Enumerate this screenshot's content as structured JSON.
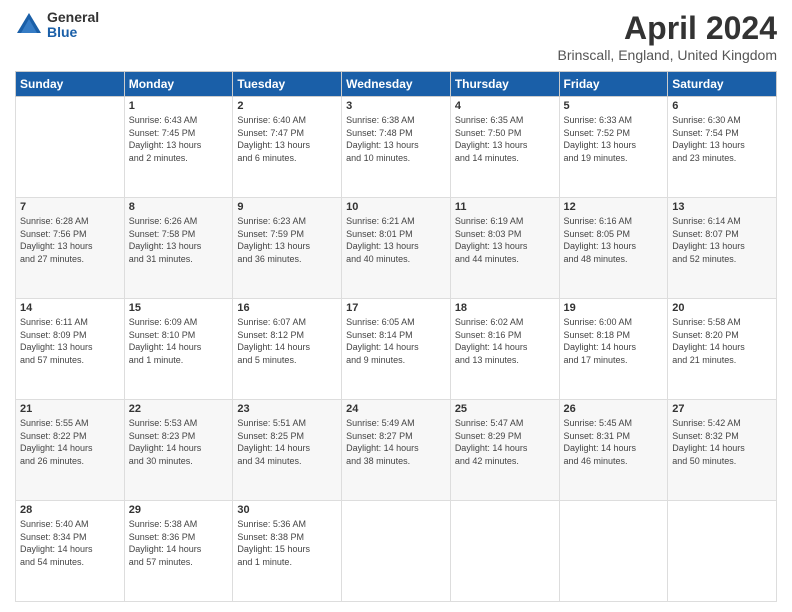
{
  "header": {
    "logo_general": "General",
    "logo_blue": "Blue",
    "main_title": "April 2024",
    "subtitle": "Brinscall, England, United Kingdom"
  },
  "calendar": {
    "days_of_week": [
      "Sunday",
      "Monday",
      "Tuesday",
      "Wednesday",
      "Thursday",
      "Friday",
      "Saturday"
    ],
    "weeks": [
      [
        {
          "num": "",
          "detail": ""
        },
        {
          "num": "1",
          "detail": "Sunrise: 6:43 AM\nSunset: 7:45 PM\nDaylight: 13 hours\nand 2 minutes."
        },
        {
          "num": "2",
          "detail": "Sunrise: 6:40 AM\nSunset: 7:47 PM\nDaylight: 13 hours\nand 6 minutes."
        },
        {
          "num": "3",
          "detail": "Sunrise: 6:38 AM\nSunset: 7:48 PM\nDaylight: 13 hours\nand 10 minutes."
        },
        {
          "num": "4",
          "detail": "Sunrise: 6:35 AM\nSunset: 7:50 PM\nDaylight: 13 hours\nand 14 minutes."
        },
        {
          "num": "5",
          "detail": "Sunrise: 6:33 AM\nSunset: 7:52 PM\nDaylight: 13 hours\nand 19 minutes."
        },
        {
          "num": "6",
          "detail": "Sunrise: 6:30 AM\nSunset: 7:54 PM\nDaylight: 13 hours\nand 23 minutes."
        }
      ],
      [
        {
          "num": "7",
          "detail": "Sunrise: 6:28 AM\nSunset: 7:56 PM\nDaylight: 13 hours\nand 27 minutes."
        },
        {
          "num": "8",
          "detail": "Sunrise: 6:26 AM\nSunset: 7:58 PM\nDaylight: 13 hours\nand 31 minutes."
        },
        {
          "num": "9",
          "detail": "Sunrise: 6:23 AM\nSunset: 7:59 PM\nDaylight: 13 hours\nand 36 minutes."
        },
        {
          "num": "10",
          "detail": "Sunrise: 6:21 AM\nSunset: 8:01 PM\nDaylight: 13 hours\nand 40 minutes."
        },
        {
          "num": "11",
          "detail": "Sunrise: 6:19 AM\nSunset: 8:03 PM\nDaylight: 13 hours\nand 44 minutes."
        },
        {
          "num": "12",
          "detail": "Sunrise: 6:16 AM\nSunset: 8:05 PM\nDaylight: 13 hours\nand 48 minutes."
        },
        {
          "num": "13",
          "detail": "Sunrise: 6:14 AM\nSunset: 8:07 PM\nDaylight: 13 hours\nand 52 minutes."
        }
      ],
      [
        {
          "num": "14",
          "detail": "Sunrise: 6:11 AM\nSunset: 8:09 PM\nDaylight: 13 hours\nand 57 minutes."
        },
        {
          "num": "15",
          "detail": "Sunrise: 6:09 AM\nSunset: 8:10 PM\nDaylight: 14 hours\nand 1 minute."
        },
        {
          "num": "16",
          "detail": "Sunrise: 6:07 AM\nSunset: 8:12 PM\nDaylight: 14 hours\nand 5 minutes."
        },
        {
          "num": "17",
          "detail": "Sunrise: 6:05 AM\nSunset: 8:14 PM\nDaylight: 14 hours\nand 9 minutes."
        },
        {
          "num": "18",
          "detail": "Sunrise: 6:02 AM\nSunset: 8:16 PM\nDaylight: 14 hours\nand 13 minutes."
        },
        {
          "num": "19",
          "detail": "Sunrise: 6:00 AM\nSunset: 8:18 PM\nDaylight: 14 hours\nand 17 minutes."
        },
        {
          "num": "20",
          "detail": "Sunrise: 5:58 AM\nSunset: 8:20 PM\nDaylight: 14 hours\nand 21 minutes."
        }
      ],
      [
        {
          "num": "21",
          "detail": "Sunrise: 5:55 AM\nSunset: 8:22 PM\nDaylight: 14 hours\nand 26 minutes."
        },
        {
          "num": "22",
          "detail": "Sunrise: 5:53 AM\nSunset: 8:23 PM\nDaylight: 14 hours\nand 30 minutes."
        },
        {
          "num": "23",
          "detail": "Sunrise: 5:51 AM\nSunset: 8:25 PM\nDaylight: 14 hours\nand 34 minutes."
        },
        {
          "num": "24",
          "detail": "Sunrise: 5:49 AM\nSunset: 8:27 PM\nDaylight: 14 hours\nand 38 minutes."
        },
        {
          "num": "25",
          "detail": "Sunrise: 5:47 AM\nSunset: 8:29 PM\nDaylight: 14 hours\nand 42 minutes."
        },
        {
          "num": "26",
          "detail": "Sunrise: 5:45 AM\nSunset: 8:31 PM\nDaylight: 14 hours\nand 46 minutes."
        },
        {
          "num": "27",
          "detail": "Sunrise: 5:42 AM\nSunset: 8:32 PM\nDaylight: 14 hours\nand 50 minutes."
        }
      ],
      [
        {
          "num": "28",
          "detail": "Sunrise: 5:40 AM\nSunset: 8:34 PM\nDaylight: 14 hours\nand 54 minutes."
        },
        {
          "num": "29",
          "detail": "Sunrise: 5:38 AM\nSunset: 8:36 PM\nDaylight: 14 hours\nand 57 minutes."
        },
        {
          "num": "30",
          "detail": "Sunrise: 5:36 AM\nSunset: 8:38 PM\nDaylight: 15 hours\nand 1 minute."
        },
        {
          "num": "",
          "detail": ""
        },
        {
          "num": "",
          "detail": ""
        },
        {
          "num": "",
          "detail": ""
        },
        {
          "num": "",
          "detail": ""
        }
      ]
    ]
  }
}
